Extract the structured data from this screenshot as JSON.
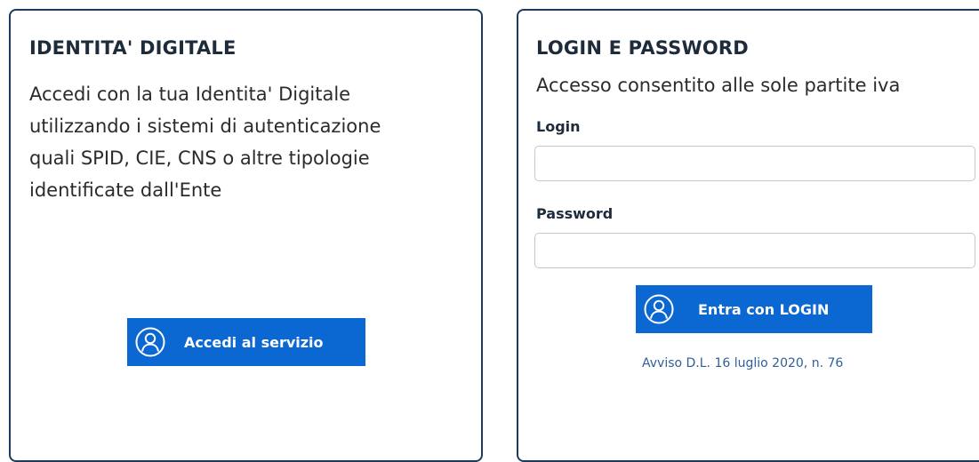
{
  "identity_card": {
    "title": "IDENTITA' DIGITALE",
    "description": "Accedi con la tua Identita' Digitale\nutilizzando i sistemi di autenticazione\nquali SPID, CIE, CNS o altre tipologie\nidentificate dall'Ente",
    "button_label": "Accedi al servizio",
    "button_icon": "user-circle-icon"
  },
  "login_card": {
    "title": "LOGIN E PASSWORD",
    "subtitle": "Accesso consentito alle sole partite iva",
    "login_label": "Login",
    "login_value": "",
    "password_label": "Password",
    "password_value": "",
    "button_label": "Entra con LOGIN",
    "button_icon": "user-circle-icon",
    "notice_link": "Avviso D.L. 16 luglio 2020, n. 76"
  },
  "colors": {
    "card_border": "#1d3b5c",
    "button_bg": "#0b67d1",
    "link": "#2f5f99"
  }
}
